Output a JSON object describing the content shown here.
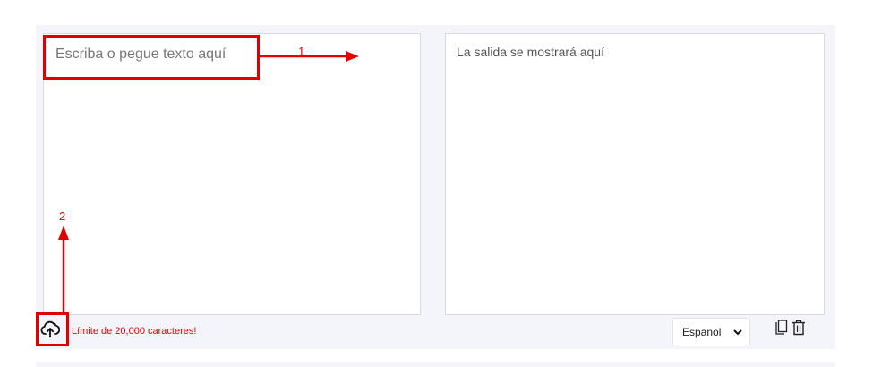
{
  "input": {
    "placeholder": "Escriba o pegue texto aquí"
  },
  "output": {
    "placeholder": "La salida se mostrará aquí"
  },
  "footer": {
    "char_limit": "Límite de 20,000 caracteres!",
    "language_selected": "Espanol"
  },
  "annotations": {
    "label_1": "1",
    "label_2": "2"
  },
  "icons": {
    "upload": "cloud-upload-icon",
    "copy": "copy-icon",
    "delete": "trash-icon",
    "dropdown": "chevron-down-icon"
  },
  "colors": {
    "annotation": "#e00000",
    "panel_bg": "#f4f4fb"
  }
}
